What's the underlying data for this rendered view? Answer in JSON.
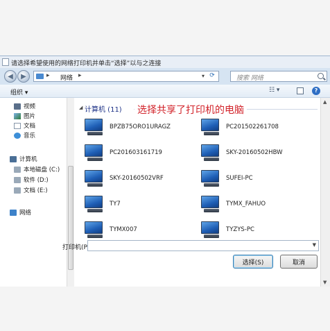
{
  "dialog": {
    "title": "请选择希望使用的网络打印机并单击“选择”以与之连接"
  },
  "address": {
    "arrow": "▸",
    "path": "网络",
    "dropdown_glyph": "▾"
  },
  "search": {
    "placeholder": "搜索 网络"
  },
  "toolbar": {
    "organize_label": "组织 ▾"
  },
  "nav": {
    "items": [
      {
        "label": "视频",
        "icon": "video-icon"
      },
      {
        "label": "图片",
        "icon": "picture-icon"
      },
      {
        "label": "文档",
        "icon": "document-icon"
      },
      {
        "label": "音乐",
        "icon": "music-icon"
      },
      {
        "label": "计算机",
        "icon": "computer-icon"
      },
      {
        "label": "本地磁盘 (C:)",
        "icon": "drive-icon"
      },
      {
        "label": "软件 (D:)",
        "icon": "drive-icon"
      },
      {
        "label": "文档 (E:)",
        "icon": "drive-icon"
      },
      {
        "label": "网络",
        "icon": "network-icon"
      }
    ]
  },
  "content": {
    "group_title": "计算机 (11)",
    "annotation": "选择共享了打印机的电脑",
    "computers": [
      "BPZB75ORO1URAGZ",
      "PC201502261708",
      "PC201603161719",
      "SKY-20160502HBW",
      "SKY-20160502VRF",
      "SUFEI-PC",
      "TY7",
      "TYMX_FAHUO",
      "TYMX007",
      "TYZYS-PC"
    ]
  },
  "printer": {
    "label": "打印机(P):",
    "value": ""
  },
  "buttons": {
    "select": "选择(S)",
    "cancel": "取消"
  },
  "colors": {
    "annotation": "#d2232a",
    "group_title": "#1e3287",
    "window_frame": "#dde9f5"
  }
}
